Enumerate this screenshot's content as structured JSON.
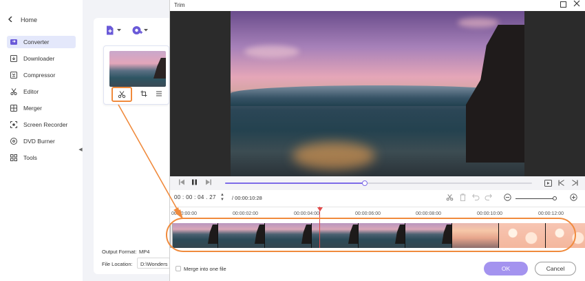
{
  "sidebar": {
    "back_label": "Home",
    "items": [
      {
        "label": "Converter",
        "icon": "converter-icon",
        "active": true
      },
      {
        "label": "Downloader",
        "icon": "downloader-icon",
        "active": false
      },
      {
        "label": "Compressor",
        "icon": "compressor-icon",
        "active": false
      },
      {
        "label": "Editor",
        "icon": "editor-icon",
        "active": false
      },
      {
        "label": "Merger",
        "icon": "merger-icon",
        "active": false
      },
      {
        "label": "Screen Recorder",
        "icon": "screen-recorder-icon",
        "active": false
      },
      {
        "label": "DVD Burner",
        "icon": "dvd-burner-icon",
        "active": false
      },
      {
        "label": "Tools",
        "icon": "tools-icon",
        "active": false
      }
    ]
  },
  "main": {
    "output_format_label": "Output Format:",
    "output_format_value": "MP4",
    "file_location_label": "File Location:",
    "file_location_value": "D:\\Wonders"
  },
  "dialog": {
    "title": "Trim",
    "current_time": "00 : 00 : 04 . 27",
    "total_time": "/ 00:00:10:28",
    "progress_fraction": 0.455,
    "zoom_fraction": 0.95,
    "ruler_labels": [
      "00:00:00:00",
      "00:00:02:00",
      "00:00:04:00",
      "00:00:06:00",
      "00:00:08:00",
      "00:00:10:00",
      "00:00:12:00"
    ],
    "merge_label": "Merge into one file",
    "ok_label": "OK",
    "cancel_label": "Cancel"
  },
  "colors": {
    "accent": "#7d6ae8",
    "annotation": "#f08a3c",
    "playhead": "#e24a4a",
    "ok_button": "#a493ef"
  }
}
